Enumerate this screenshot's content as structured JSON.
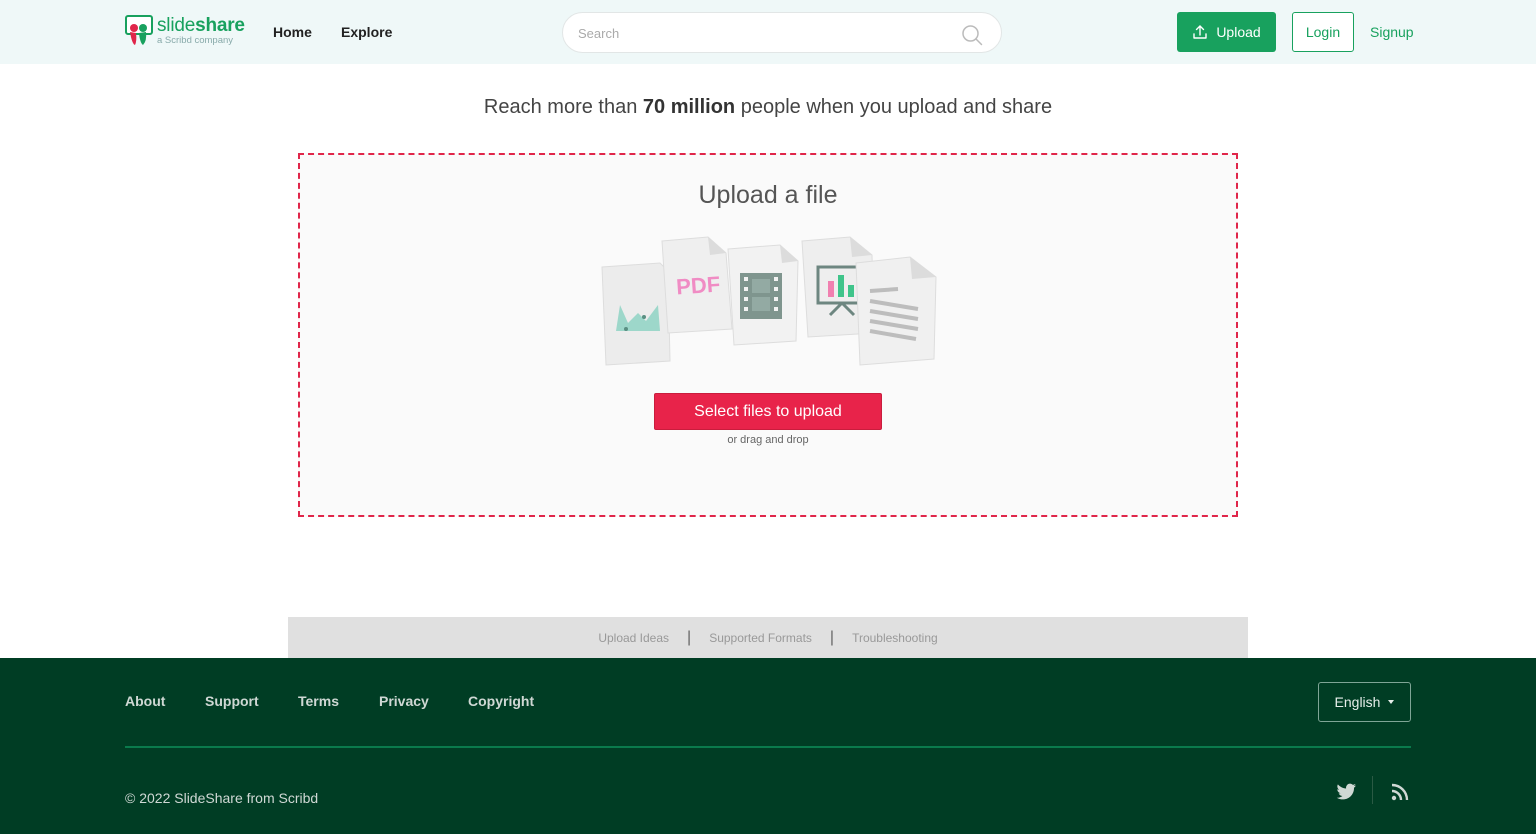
{
  "header": {
    "logo_word": "slideshare",
    "logo_tagline": "a Scribd company",
    "nav": {
      "home": "Home",
      "explore": "Explore"
    },
    "search_placeholder": "Search",
    "upload_label": "Upload",
    "login_label": "Login",
    "signup_label": "Signup"
  },
  "main": {
    "tagline_prefix": "Reach more than",
    "tagline_bold": "70 million",
    "tagline_suffix": "people when you upload and share",
    "dropzone": {
      "title": "Upload a file",
      "illustration_pdf_text": "PDF",
      "select_button": "Select files to upload",
      "hint": "or drag and drop"
    },
    "help_links": [
      "Upload Ideas",
      "Supported Formats",
      "Troubleshooting"
    ]
  },
  "footer": {
    "links": [
      "About",
      "Support",
      "Terms",
      "Privacy",
      "Copyright"
    ],
    "language": "English",
    "copyright": "© 2022 SlideShare from Scribd",
    "social_icons": [
      "twitter-icon",
      "rss-icon"
    ]
  },
  "colors": {
    "brand_green": "#18a15e",
    "header_bg": "#eff8f8",
    "accent_red": "#e8234a",
    "footer_bg": "#003d24"
  }
}
